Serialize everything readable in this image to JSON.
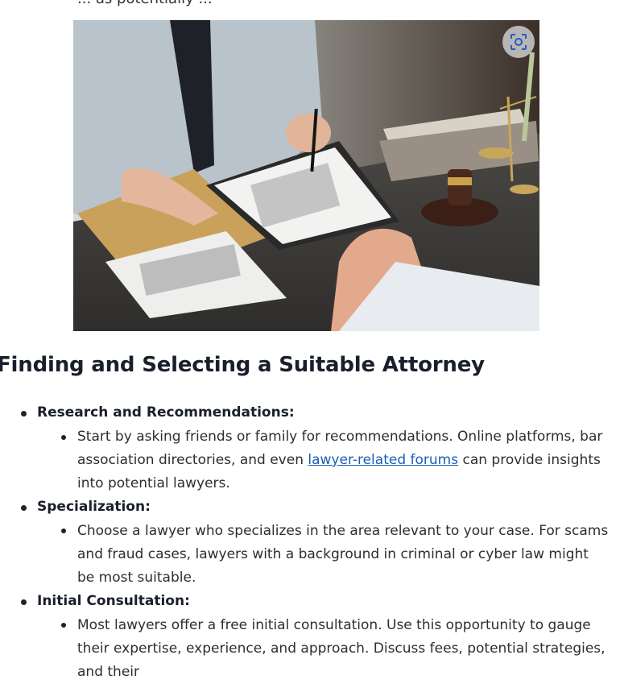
{
  "top_fragment": "... as potentially ...",
  "image": {
    "alt": "Lawyer consulting a client at a desk with a gavel, scales and documents",
    "visual_search_icon": "lens-scan-icon"
  },
  "section": {
    "title": "Finding and Selecting a Suitable Attorney",
    "items": [
      {
        "label": "Research and Recommendations:",
        "text_before_link": "Start by asking friends or family for recommendations. Online platforms, bar association directories, and even ",
        "link": "lawyer-related forums",
        "text_after_link": " can provide insights into potential lawyers."
      },
      {
        "label": "Specialization:",
        "text": "Choose a lawyer who specializes in the area relevant to your case. For scams and fraud cases, lawyers with a background in criminal or cyber law might be most suitable."
      },
      {
        "label": "Initial Consultation:",
        "text": "Most lawyers offer a free initial consultation. Use this opportunity to gauge their expertise, experience, and approach. Discuss fees, potential strategies, and their"
      }
    ]
  }
}
